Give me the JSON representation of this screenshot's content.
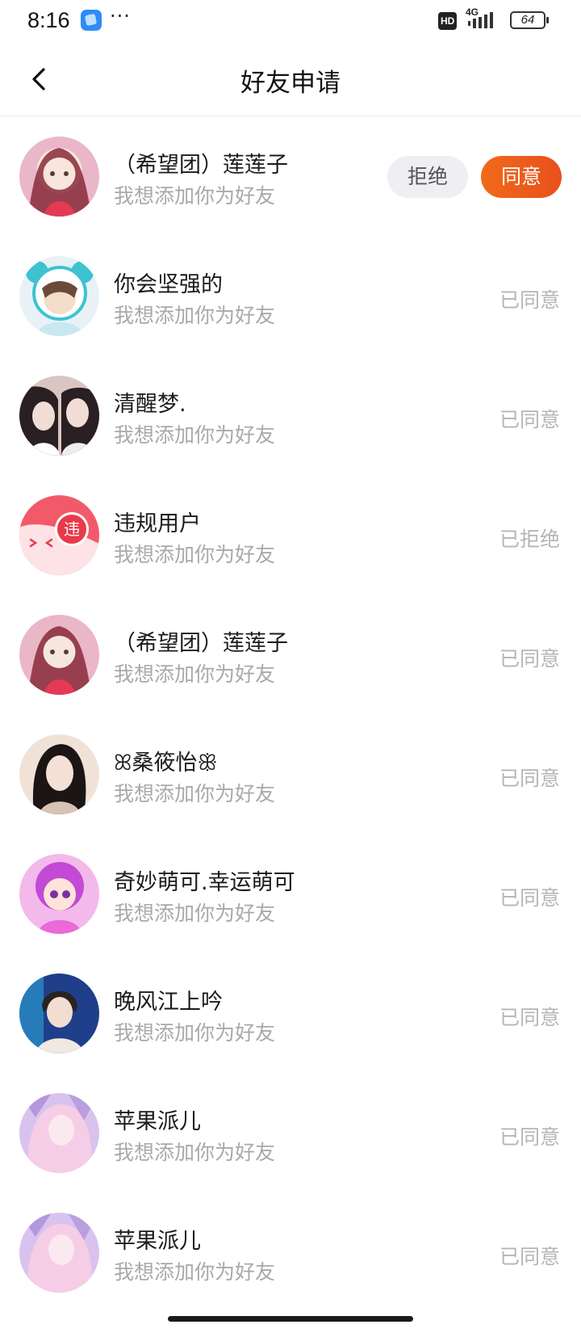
{
  "status_bar": {
    "time": "8:16",
    "dots": "···",
    "hd": "HD",
    "network": "4G",
    "battery": "64"
  },
  "nav": {
    "title": "好友申请"
  },
  "requests": [
    {
      "name": "（希望团）莲莲子",
      "message": "我想添加你为好友",
      "status": "",
      "reject_label": "拒绝",
      "accept_label": "同意",
      "avatar_colors": [
        "#8a2a3a",
        "#e9b7c8"
      ]
    },
    {
      "name": "你会坚强的",
      "message": "我想添加你为好友",
      "status": "已同意",
      "avatar_colors": [
        "#4fc9d6",
        "#e8f2f6"
      ]
    },
    {
      "name": "清醒梦.",
      "message": "我想添加你为好友",
      "status": "已同意",
      "avatar_colors": [
        "#2a1f22",
        "#e7c9c2"
      ]
    },
    {
      "name": "违规用户",
      "message": "我想添加你为好友",
      "status": "已拒绝",
      "violation_mark": "违",
      "avatar_colors": [
        "#f25a6a",
        "#fde3e6"
      ]
    },
    {
      "name": "（希望团）莲莲子",
      "message": "我想添加你为好友",
      "status": "已同意",
      "avatar_colors": [
        "#8a2a3a",
        "#e9b7c8"
      ]
    },
    {
      "name": "ꕤ桑筱怡ꕥ",
      "message": "我想添加你为好友",
      "status": "已同意",
      "avatar_colors": [
        "#1b1515",
        "#f1e2d8"
      ]
    },
    {
      "name": "奇妙萌可.幸运萌可",
      "message": "我想添加你为好友",
      "status": "已同意",
      "avatar_colors": [
        "#c24ad6",
        "#f3b9ea"
      ]
    },
    {
      "name": "晚风江上吟",
      "message": "我想添加你为好友",
      "status": "已同意",
      "avatar_colors": [
        "#1f3f8a",
        "#f0e8e2"
      ]
    },
    {
      "name": "苹果派儿",
      "message": "我想添加你为好友",
      "status": "已同意",
      "avatar_colors": [
        "#9c7ad0",
        "#f6cde6"
      ]
    },
    {
      "name": "苹果派儿",
      "message": "我想添加你为好友",
      "status": "已同意",
      "avatar_colors": [
        "#9c7ad0",
        "#f6cde6"
      ]
    }
  ],
  "colors": {
    "accent": "#ee5b1b",
    "status_text": "#b5b5b5",
    "secondary_text": "#a9a9a9"
  }
}
